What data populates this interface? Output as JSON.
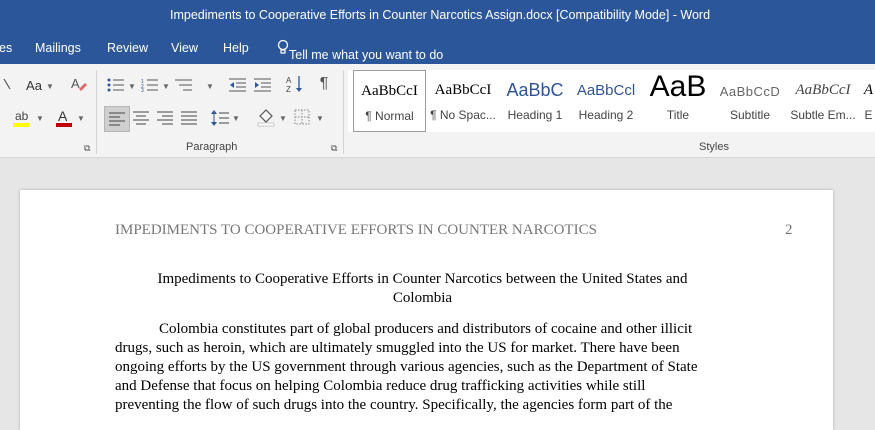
{
  "window": {
    "title": "Impediments to Cooperative Efforts in Counter Narcotics Assign.docx [Compatibility Mode]  -  Word"
  },
  "menu": {
    "tabs": [
      "es",
      "Mailings",
      "Review",
      "View",
      "Help"
    ],
    "tell_me": "Tell me what you want to do"
  },
  "ribbon": {
    "font_size_label": "Aa",
    "groups": {
      "paragraph": "Paragraph",
      "styles": "Styles"
    },
    "styles": [
      {
        "preview": "AaBbCcI",
        "label": "¶ Normal"
      },
      {
        "preview": "AaBbCcI",
        "label": "¶ No Spac..."
      },
      {
        "preview": "AaBbC",
        "label": "Heading 1"
      },
      {
        "preview": "AaBbCcl",
        "label": "Heading 2"
      },
      {
        "preview": "AaB",
        "label": "Title"
      },
      {
        "preview": "AaBbCcD",
        "label": "Subtitle"
      },
      {
        "preview": "AaBbCcI",
        "label": "Subtle Em..."
      },
      {
        "preview": "A",
        "label": "E"
      }
    ]
  },
  "document": {
    "header": "IMPEDIMENTS TO COOPERATIVE EFFORTS IN COUNTER NARCOTICS",
    "page_number": "2",
    "title_line1": "Impediments to Cooperative Efforts in Counter Narcotics between the United States and",
    "title_line2": "Colombia",
    "body_lines": [
      "Colombia constitutes part of global producers and distributors of cocaine and other illicit",
      "drugs, such as heroin, which are ultimately smuggled into the US for market. There have been",
      "ongoing efforts by the US government through various agencies, such as the Department of State",
      "and Defense that focus on helping Colombia reduce drug trafficking activities while still",
      "preventing the flow of such drugs into the country. Specifically, the agencies form part of the"
    ]
  },
  "colors": {
    "accent": "#2b579a",
    "ribbon_bg": "#f3f3f3",
    "canvas_bg": "#e6e6e6",
    "heading": "#2f5496"
  }
}
